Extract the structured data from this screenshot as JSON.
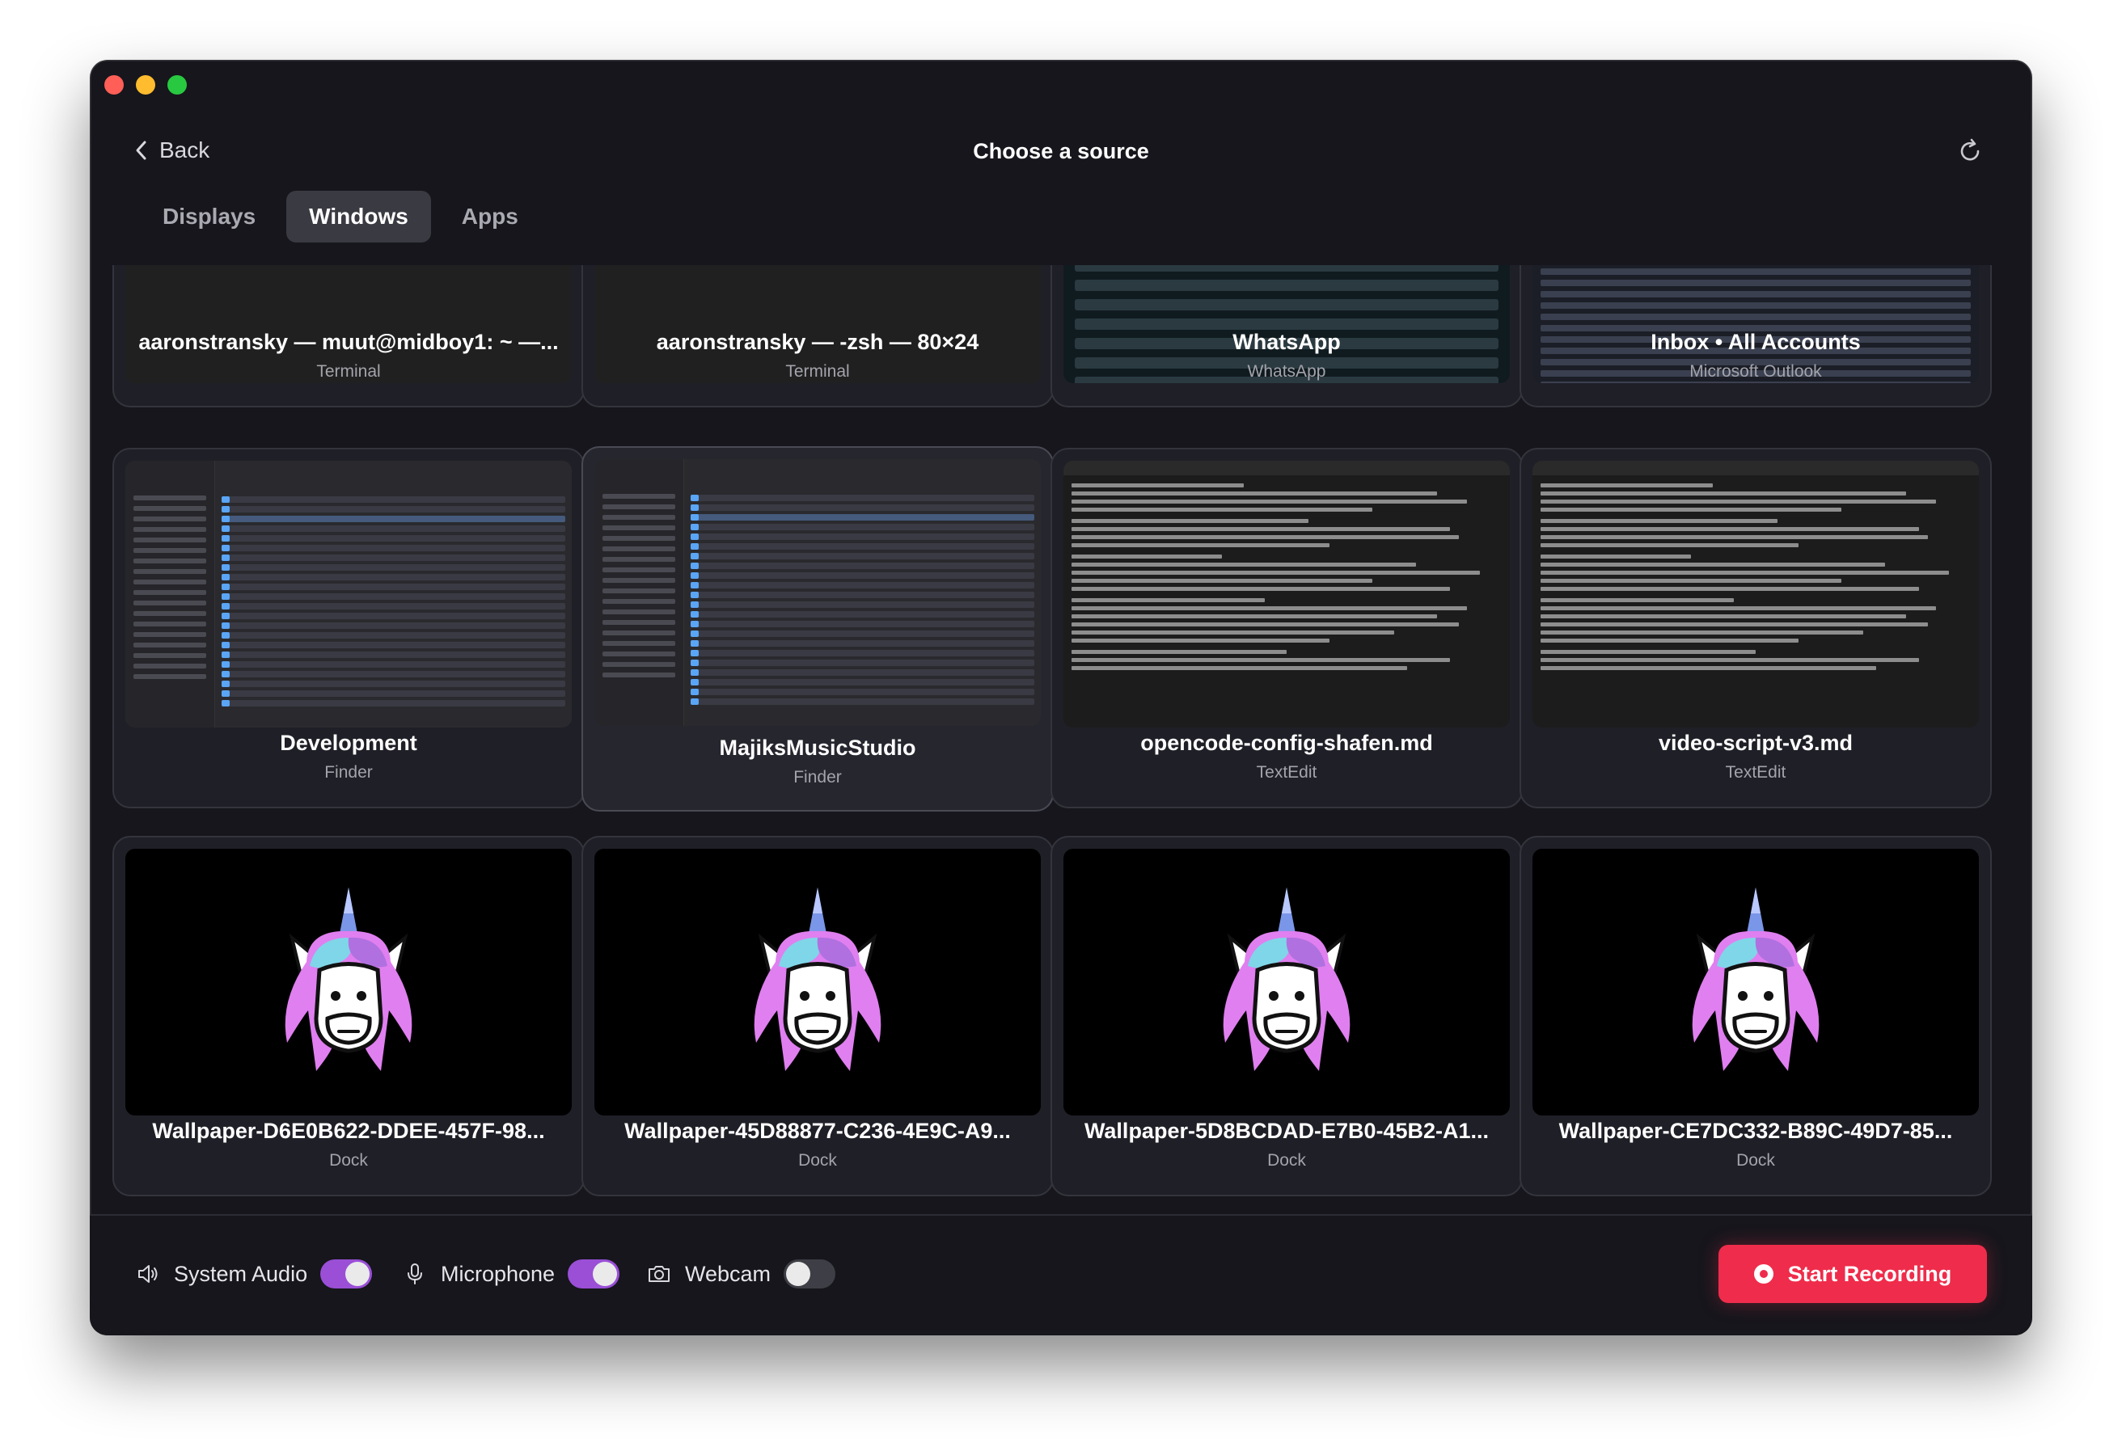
{
  "header": {
    "back_label": "Back",
    "title": "Choose a source"
  },
  "tabs": [
    {
      "label": "Displays",
      "active": false
    },
    {
      "label": "Windows",
      "active": true
    },
    {
      "label": "Apps",
      "active": false
    }
  ],
  "cards": [
    {
      "title": "aaronstransky — muut@midboy1: ~ —...",
      "app": "Terminal",
      "thumb": "terminal"
    },
    {
      "title": "aaronstransky — -zsh — 80×24",
      "app": "Terminal",
      "thumb": "terminal"
    },
    {
      "title": "WhatsApp",
      "app": "WhatsApp",
      "thumb": "whatsapp"
    },
    {
      "title": "Inbox • All Accounts",
      "app": "Microsoft Outlook",
      "thumb": "outlook"
    },
    {
      "title": "Development",
      "app": "Finder",
      "thumb": "finder"
    },
    {
      "title": "MajiksMusicStudio",
      "app": "Finder",
      "thumb": "finder"
    },
    {
      "title": "opencode-config-shafen.md",
      "app": "TextEdit",
      "thumb": "text"
    },
    {
      "title": "video-script-v3.md",
      "app": "TextEdit",
      "thumb": "text"
    },
    {
      "title": "Wallpaper-D6E0B622-DDEE-457F-98...",
      "app": "Dock",
      "thumb": "wallpaper"
    },
    {
      "title": "Wallpaper-45D88877-C236-4E9C-A9...",
      "app": "Dock",
      "thumb": "wallpaper"
    },
    {
      "title": "Wallpaper-5D8BCDAD-E7B0-45B2-A1...",
      "app": "Dock",
      "thumb": "wallpaper"
    },
    {
      "title": "Wallpaper-CE7DC332-B89C-49D7-85...",
      "app": "Dock",
      "thumb": "wallpaper"
    }
  ],
  "footer": {
    "system_audio_label": "System Audio",
    "system_audio_on": true,
    "microphone_label": "Microphone",
    "microphone_on": true,
    "webcam_label": "Webcam",
    "webcam_on": false,
    "record_label": "Start Recording"
  },
  "colors": {
    "accent_toggle": "#9a4fd6",
    "record_button": "#ef2c4b",
    "window_bg": "#16161c"
  }
}
